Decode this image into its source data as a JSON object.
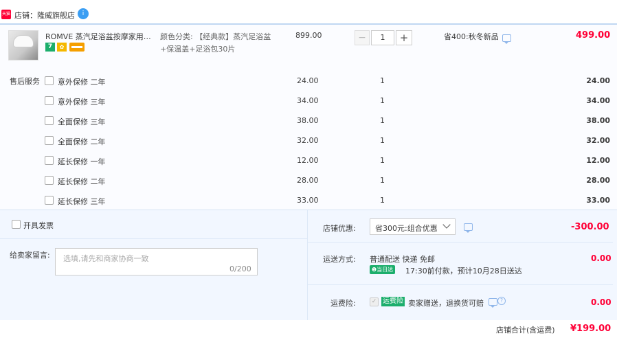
{
  "shop": {
    "badge": "天猫",
    "label": "店铺：隆威旗舰店",
    "chat_icon": "i"
  },
  "item": {
    "title": "ROMVE 蒸汽足浴盆按摩家用洗...",
    "badges": [
      "7",
      "✿"
    ],
    "sku_line1": "颜色分类: 【经典款】蒸汽足浴盆",
    "sku_line2": "+保温盖+足浴包30片",
    "unit_price": "899.00",
    "quantity": "1",
    "qty_minus": "−",
    "qty_plus": "+",
    "promotion": "省400:秋冬新品",
    "subtotal": "499.00"
  },
  "services": {
    "label": "售后服务",
    "rows": [
      {
        "name": "意外保修 二年",
        "price": "24.00",
        "qty": "1",
        "total": "24.00"
      },
      {
        "name": "意外保修 三年",
        "price": "34.00",
        "qty": "1",
        "total": "34.00"
      },
      {
        "name": "全面保修 三年",
        "price": "38.00",
        "qty": "1",
        "total": "38.00"
      },
      {
        "name": "全面保修 二年",
        "price": "32.00",
        "qty": "1",
        "total": "32.00"
      },
      {
        "name": "延长保修 一年",
        "price": "12.00",
        "qty": "1",
        "total": "12.00"
      },
      {
        "name": "延长保修 二年",
        "price": "28.00",
        "qty": "1",
        "total": "28.00"
      },
      {
        "name": "延长保修 三年",
        "price": "33.00",
        "qty": "1",
        "total": "33.00"
      }
    ]
  },
  "invoice": {
    "label": "开具发票"
  },
  "message": {
    "label": "给卖家留言:",
    "placeholder": "选填,请先和商家协商一致",
    "count": "0/200"
  },
  "discount": {
    "label": "店铺优惠:",
    "selected": "省300元:组合优惠",
    "amount": "-300.00"
  },
  "shipping": {
    "label": "运送方式:",
    "method": "普通配送 快递 免邮",
    "tag": "❶当日达",
    "eta": "17:30前付款，预计10月28日送达",
    "amount": "0.00"
  },
  "insurance": {
    "label": "运费险:",
    "check": "✓",
    "tag": "运费险",
    "desc": "卖家赠送，退换货可赔",
    "help": "?",
    "amount": "0.00"
  },
  "total": {
    "label": "店铺合计(含运费)",
    "value": "¥199.00"
  },
  "colors": {
    "accent_red": "#ff0036",
    "panel_blue": "#f2f7ff",
    "green_tag": "#1cae6c"
  }
}
